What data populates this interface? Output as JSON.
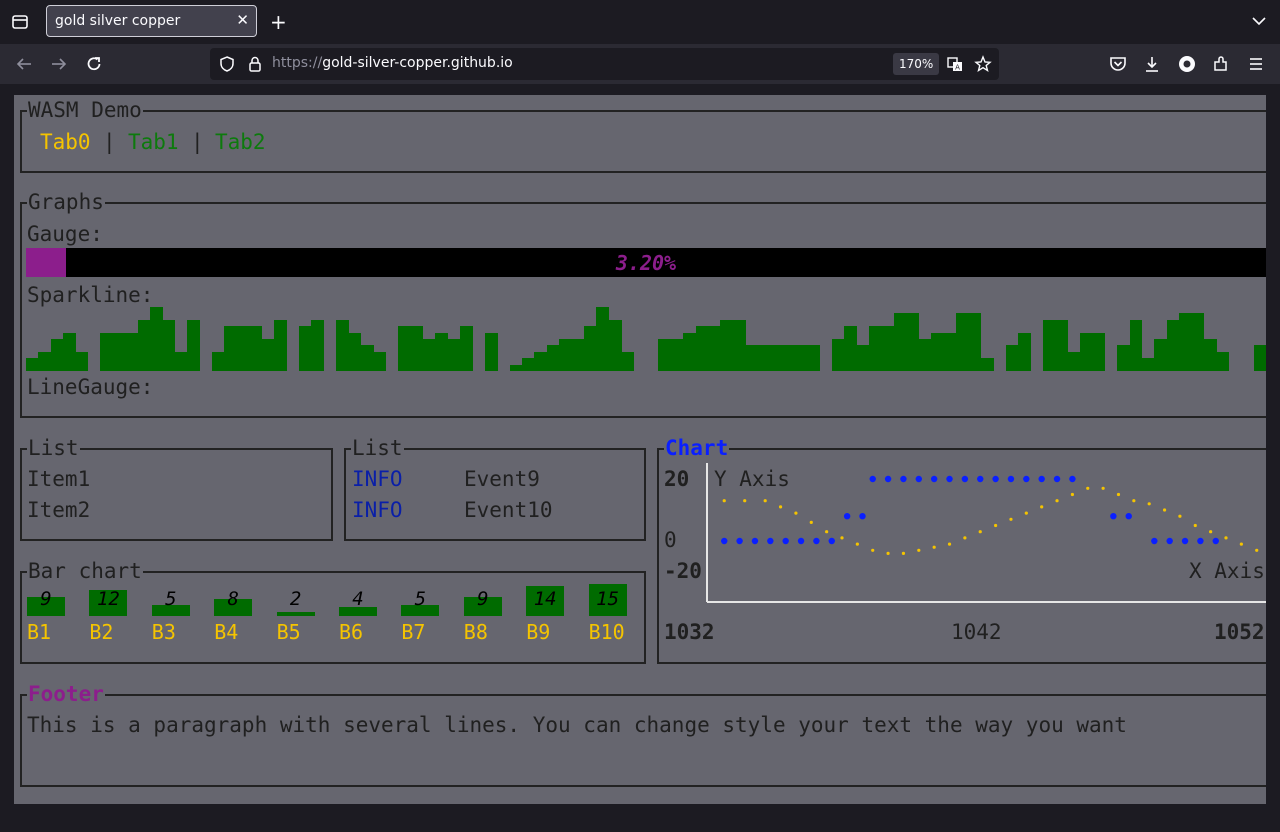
{
  "browser": {
    "tab_title": "gold silver copper",
    "url_protocol": "https://",
    "url_host": "gold-silver-copper.github.io",
    "zoom": "170%"
  },
  "app": {
    "tabs_block": {
      "title": "WASM Demo",
      "tabs": [
        "Tab0",
        "Tab1",
        "Tab2"
      ],
      "separator": "|",
      "selected": 0,
      "selected_color": "#f5c400",
      "tab_color": "#0d7a0d"
    },
    "graphs": {
      "title": "Graphs",
      "gauge_label": "Gauge:",
      "gauge_value": 0.032,
      "gauge_text": "3.20%",
      "sparkline_label": "Sparkline:",
      "sparkline": [
        2,
        3,
        5,
        6,
        3,
        0,
        6,
        6,
        6,
        8,
        10,
        8,
        3,
        8,
        0,
        3,
        7,
        7,
        7,
        5,
        8,
        0,
        7,
        8,
        0,
        8,
        6,
        4,
        3,
        0,
        7,
        7,
        5,
        6,
        5,
        7,
        0,
        6,
        0,
        1,
        2,
        3,
        4,
        5,
        5,
        7,
        10,
        8,
        3,
        0,
        0,
        5,
        5,
        6,
        7,
        7,
        8,
        8,
        4,
        4,
        4,
        4,
        4,
        4,
        0,
        5,
        7,
        4,
        7,
        7,
        9,
        9,
        5,
        6,
        6,
        9,
        9,
        2,
        0,
        4,
        6,
        0,
        8,
        8,
        3,
        6,
        6,
        0,
        4,
        8,
        2,
        5,
        8,
        9,
        9,
        5,
        3,
        0,
        0,
        4,
        6,
        2
      ],
      "sparkline_color": "#006b00",
      "linegauge_label": "LineGauge:"
    },
    "list1": {
      "title": "List",
      "items": [
        "Item1",
        "Item2"
      ]
    },
    "list2": {
      "title": "List",
      "events": [
        {
          "level": "INFO",
          "name": "Event9"
        },
        {
          "level": "INFO",
          "name": "Event10"
        }
      ],
      "level_color": "#0a1fa8"
    },
    "barchart": {
      "title": "Bar chart",
      "bars": [
        {
          "label": "B1",
          "value": 9
        },
        {
          "label": "B2",
          "value": 12
        },
        {
          "label": "B3",
          "value": 5
        },
        {
          "label": "B4",
          "value": 8
        },
        {
          "label": "B5",
          "value": 2
        },
        {
          "label": "B6",
          "value": 4
        },
        {
          "label": "B7",
          "value": 5
        },
        {
          "label": "B8",
          "value": 9
        },
        {
          "label": "B9",
          "value": 14
        },
        {
          "label": "B10",
          "value": 15
        }
      ],
      "bar_color": "#006b00",
      "label_color": "#f5c400"
    },
    "chart": {
      "title": "Chart",
      "title_color": "#0a1fff",
      "y_axis_label": "Y Axis",
      "x_axis_label": "X Axis",
      "y_ticks": [
        "20",
        "0",
        "-20"
      ],
      "x_ticks": [
        "1032",
        "1042",
        "1052"
      ]
    },
    "footer": {
      "title": "Footer",
      "title_color": "#8c1e8c",
      "text": "This is a paragraph with several lines. You can change style your text the way you want"
    }
  },
  "chart_data": {
    "type": "scatter",
    "title": "Chart",
    "xlabel": "X Axis",
    "ylabel": "Y Axis",
    "xlim": [
      1032,
      1052
    ],
    "ylim": [
      -20,
      20
    ],
    "x_ticks": [
      1032,
      1042,
      1052
    ],
    "y_ticks": [
      20,
      0,
      -20
    ],
    "series": [
      {
        "color": "#f5c400",
        "marker": "dot",
        "points": [
          [
            1032.4,
            13
          ],
          [
            1033.2,
            13
          ],
          [
            1034.0,
            13
          ],
          [
            1034.6,
            11
          ],
          [
            1035.2,
            9
          ],
          [
            1035.8,
            6
          ],
          [
            1036.4,
            3
          ],
          [
            1037.0,
            1
          ],
          [
            1037.6,
            -1
          ],
          [
            1038.2,
            -3
          ],
          [
            1038.8,
            -4
          ],
          [
            1039.4,
            -4
          ],
          [
            1040.0,
            -3
          ],
          [
            1040.6,
            -2
          ],
          [
            1041.2,
            -1
          ],
          [
            1041.8,
            1
          ],
          [
            1042.4,
            3
          ],
          [
            1043.0,
            5
          ],
          [
            1043.6,
            7
          ],
          [
            1044.2,
            9
          ],
          [
            1044.8,
            11
          ],
          [
            1045.4,
            13
          ],
          [
            1046.0,
            15
          ],
          [
            1046.6,
            17
          ],
          [
            1047.2,
            17
          ],
          [
            1047.8,
            15
          ],
          [
            1048.4,
            13
          ],
          [
            1049.0,
            12
          ],
          [
            1049.6,
            10
          ],
          [
            1050.2,
            8
          ],
          [
            1050.8,
            5
          ],
          [
            1051.4,
            3
          ],
          [
            1052.0,
            1
          ],
          [
            1052.6,
            -1
          ],
          [
            1053.2,
            -3
          ]
        ]
      },
      {
        "color": "#0a1fff",
        "marker": "dot",
        "points": [
          [
            1032.4,
            0
          ],
          [
            1033.0,
            0
          ],
          [
            1033.6,
            0
          ],
          [
            1034.2,
            0
          ],
          [
            1034.8,
            0
          ],
          [
            1035.4,
            0
          ],
          [
            1036.0,
            0
          ],
          [
            1036.6,
            0
          ],
          [
            1037.2,
            8
          ],
          [
            1037.8,
            8
          ],
          [
            1038.2,
            20
          ],
          [
            1038.8,
            20
          ],
          [
            1039.4,
            20
          ],
          [
            1040.0,
            20
          ],
          [
            1040.6,
            20
          ],
          [
            1041.2,
            20
          ],
          [
            1041.8,
            20
          ],
          [
            1042.4,
            20
          ],
          [
            1043.0,
            20
          ],
          [
            1043.6,
            20
          ],
          [
            1044.2,
            20
          ],
          [
            1044.8,
            20
          ],
          [
            1045.4,
            20
          ],
          [
            1046.0,
            20
          ],
          [
            1047.6,
            8
          ],
          [
            1048.2,
            8
          ],
          [
            1049.2,
            0
          ],
          [
            1049.8,
            0
          ],
          [
            1050.4,
            0
          ],
          [
            1051.0,
            0
          ],
          [
            1051.6,
            0
          ]
        ]
      }
    ]
  }
}
